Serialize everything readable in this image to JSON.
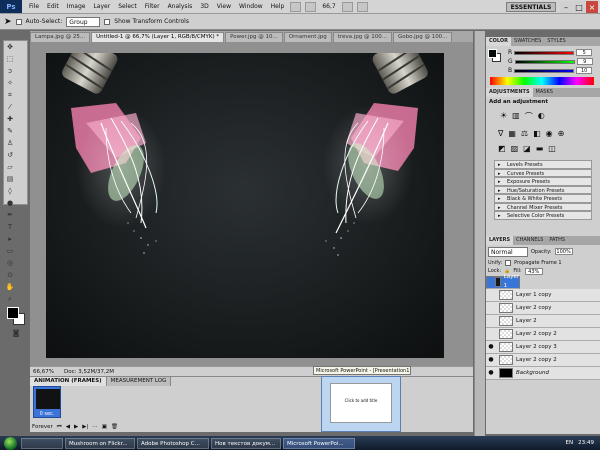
{
  "app": {
    "logo": "Ps"
  },
  "menu": [
    "File",
    "Edit",
    "Image",
    "Layer",
    "Select",
    "Filter",
    "Analysis",
    "3D",
    "View",
    "Window",
    "Help"
  ],
  "zoom_menu": "66,7",
  "workspace": "ESSENTIALS",
  "window_buttons": {
    "minimize": "–",
    "maximize": "□",
    "close": "×"
  },
  "options_bar": {
    "auto_select_label": "Auto-Select:",
    "auto_select_value": "Group",
    "transform_label": "Show Transform Controls"
  },
  "doc_tabs": [
    "Lampa.jpg @ 25...",
    "Untitled-1 @ 66,7% (Layer 1, RGB/8/CMYK) *",
    "Power.jpg @ 10...",
    "Ornament.jpg",
    "treva.jpg @ 100...",
    "Gobo.jpg @ 100..."
  ],
  "status": {
    "zoom": "66,67%",
    "doc": "Doc: 3,52M/37,2M"
  },
  "animation_panel": {
    "tab_active": "ANIMATION (FRAMES)",
    "tab_other": "MEASUREMENT LOG",
    "frame_delay": "0 sec.",
    "loop": "Forever"
  },
  "color_panel": {
    "tabs": [
      "COLOR",
      "SWATCHES",
      "STYLES"
    ],
    "r": "5",
    "g": "9",
    "b": "10"
  },
  "adjustments": {
    "tabs": [
      "ADJUSTMENTS",
      "MASKS"
    ],
    "title": "Add an adjustment",
    "presets": [
      "Levels Presets",
      "Curves Presets",
      "Exposure Presets",
      "Hue/Saturation Presets",
      "Black & White Presets",
      "Channel Mixer Presets",
      "Selective Color Presets"
    ]
  },
  "layers_panel": {
    "tabs": [
      "LAYERS",
      "CHANNELS",
      "PATHS"
    ],
    "blend": "Normal",
    "opacity_label": "Opacity:",
    "opacity": "100%",
    "unify_label": "Unify:",
    "propagate_label": "Propagate Frame 1",
    "lock_label": "Lock:",
    "fill_label": "Fill:",
    "fill": "43%",
    "layers": [
      {
        "name": "Layer 1",
        "selected": true
      },
      {
        "name": "Layer 1 copy",
        "selected": false
      },
      {
        "name": "Layer 2 copy",
        "selected": false
      },
      {
        "name": "Layer 2",
        "selected": false
      },
      {
        "name": "Layer 2 copy 2",
        "selected": false
      },
      {
        "name": "Layer 2 copy 3",
        "selected": false
      },
      {
        "name": "Layer 2 copy 2",
        "selected": false
      },
      {
        "name": "Background",
        "selected": false
      }
    ]
  },
  "tooltip": "Microsoft PowerPoint - [Presentation1]",
  "preview_text": "Click to add title",
  "taskbar": {
    "items": [
      "Mushroom on Flickr...",
      "Adobe Photoshop C...",
      "Нов текстов докум...",
      "Microsoft PowerPoi..."
    ],
    "lang": "EN",
    "time": "23:49"
  }
}
